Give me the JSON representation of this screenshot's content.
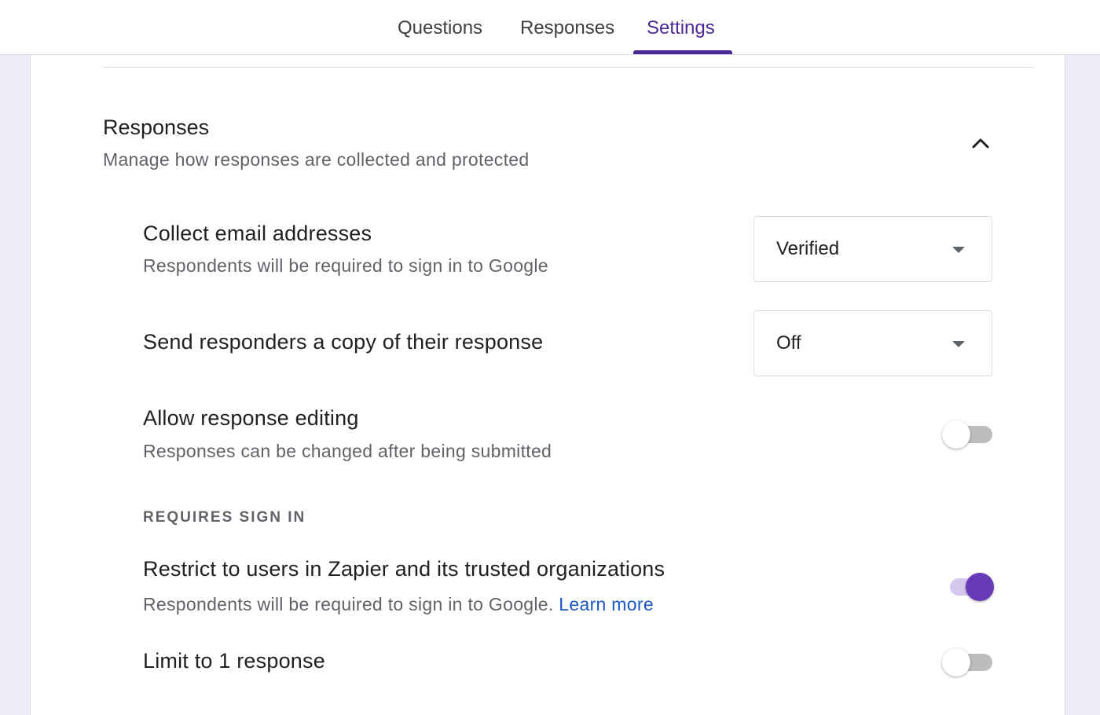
{
  "tabs": [
    {
      "label": "Questions",
      "active": false
    },
    {
      "label": "Responses",
      "active": false
    },
    {
      "label": "Settings",
      "active": true
    }
  ],
  "colors": {
    "accent": "#673ab7",
    "tab_active": "#4b2a96",
    "page_background": "#f0ebf8",
    "link": "#1a56c4"
  },
  "section": {
    "title": "Responses",
    "subtitle": "Manage how responses are collected and protected",
    "collapse_icon": "chevron-up-icon",
    "expanded": true
  },
  "settings": {
    "collect_email": {
      "title": "Collect email addresses",
      "description": "Respondents will be required to sign in to Google",
      "selected_value": "Verified",
      "icon": "dropdown-arrow-icon"
    },
    "send_copy": {
      "title": "Send responders a copy of their response",
      "selected_value": "Off",
      "icon": "dropdown-arrow-icon"
    },
    "allow_editing": {
      "title": "Allow response editing",
      "description": "Responses can be changed after being submitted",
      "enabled": false
    },
    "requires_sign_in_label": "REQUIRES SIGN IN",
    "restrict_users": {
      "title": "Restrict to users in Zapier and its trusted organizations",
      "description": "Respondents will be required to sign in to Google.",
      "link_text": "Learn more",
      "enabled": true
    },
    "limit_one": {
      "title": "Limit to 1 response",
      "enabled": false
    }
  }
}
